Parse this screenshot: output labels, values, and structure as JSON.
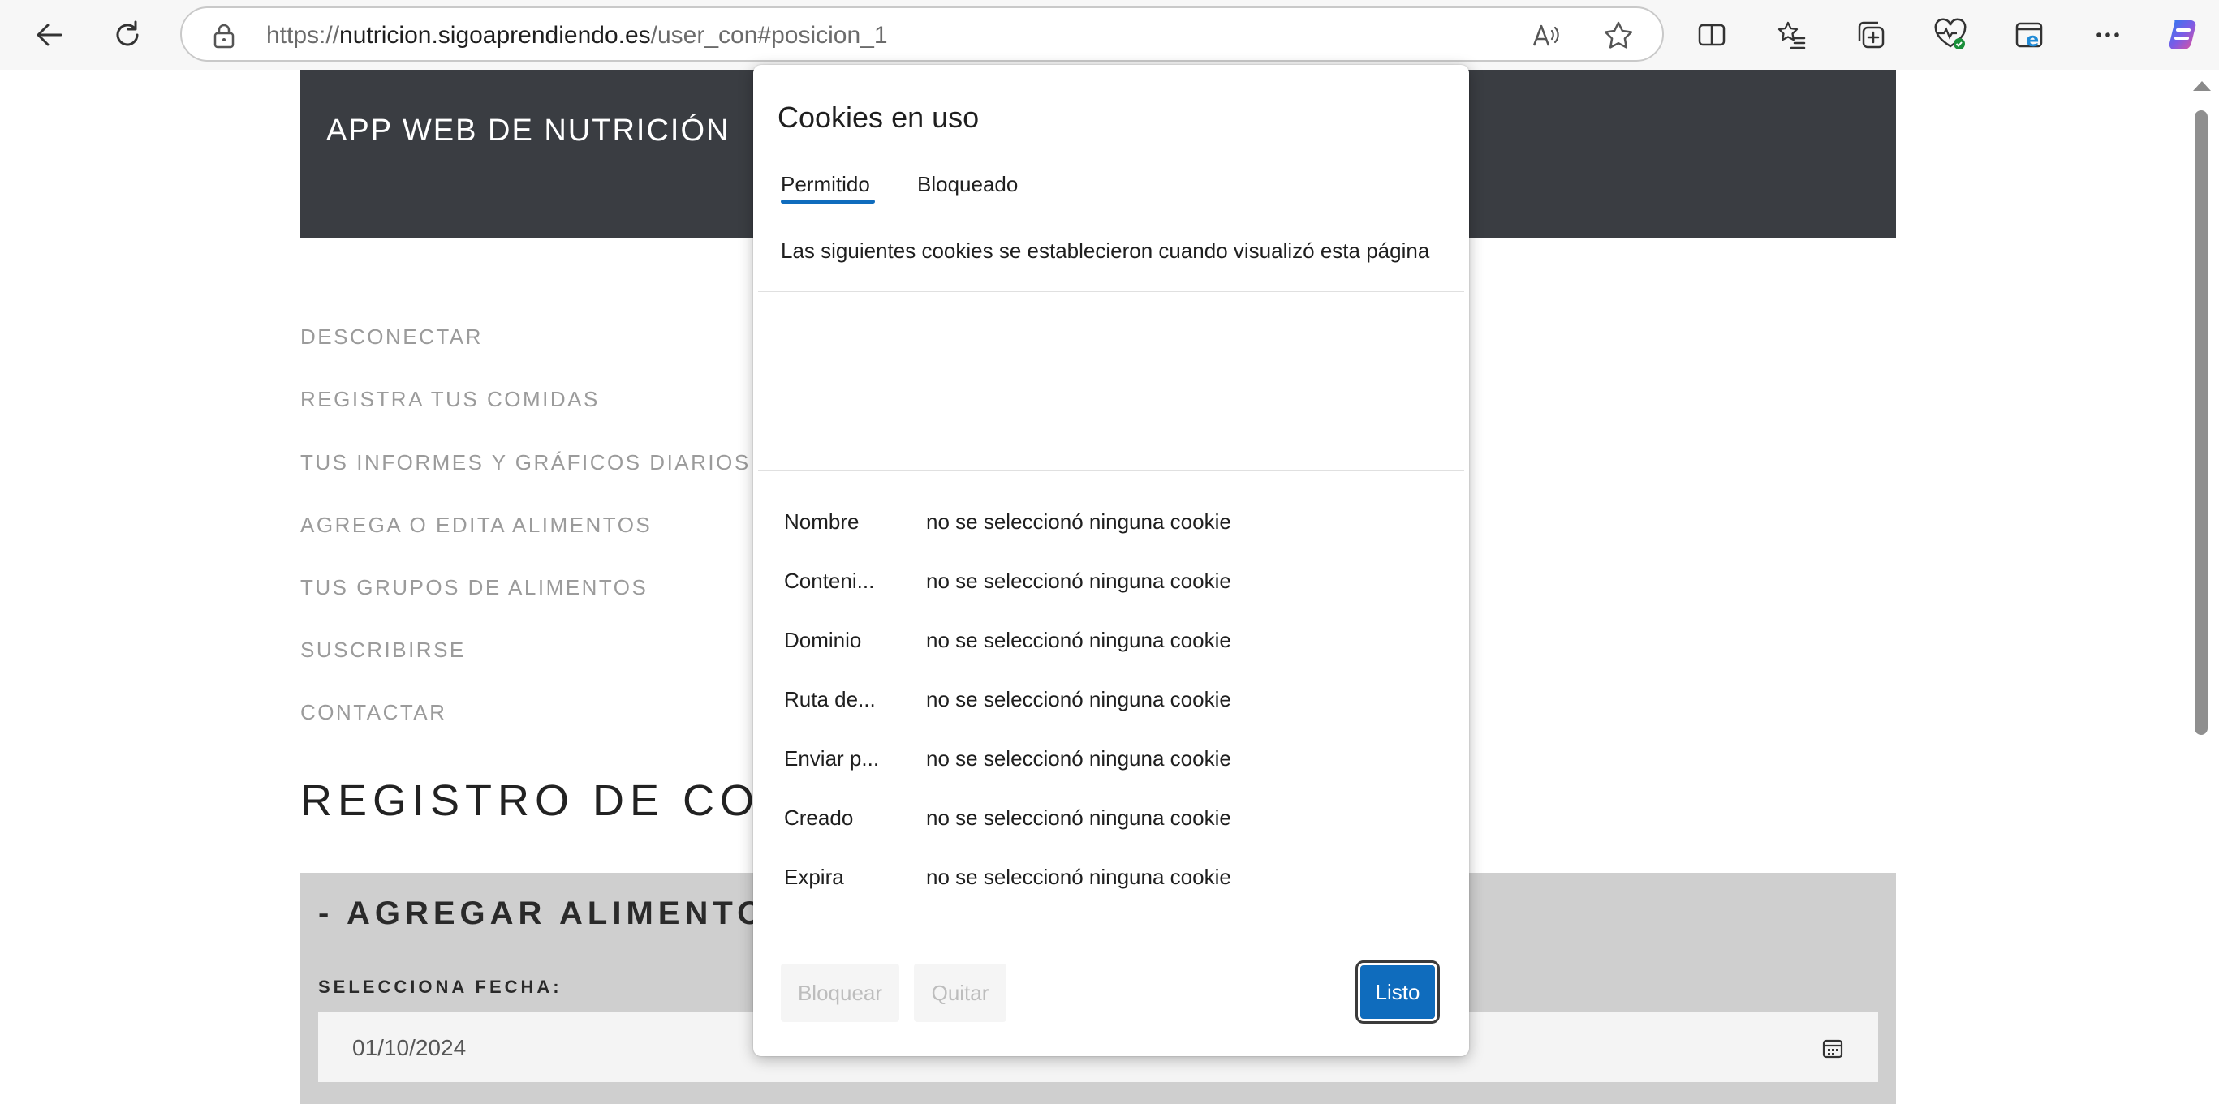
{
  "browser": {
    "url_prefix": "https://",
    "url_host": "nutricion.sigoaprendiendo.es",
    "url_path": "/user_con#posicion_1"
  },
  "site": {
    "title": "APP WEB DE NUTRICIÓN",
    "nav": [
      "DESCONECTAR",
      "REGISTRA TUS COMIDAS",
      "TUS INFORMES Y GRÁFICOS DIARIOS",
      "AGREGA O EDITA ALIMENTOS",
      "TUS GRUPOS DE ALIMENTOS",
      "SUSCRIBIRSE",
      "CONTACTAR"
    ],
    "page_heading": "REGISTRO DE COMID",
    "panel_title": "- AGREGAR ALIMENTOS -",
    "date_label": "SELECCIONA FECHA:",
    "date_value": "01/10/2024"
  },
  "cookie_popup": {
    "title": "Cookies en uso",
    "tabs": [
      "Permitido",
      "Bloqueado"
    ],
    "active_tab": "Permitido",
    "description": "Las siguientes cookies se establecieron cuando visualizó esta página",
    "details": [
      {
        "key": "Nombre",
        "value": "no se seleccionó ninguna cookie"
      },
      {
        "key": "Conteni...",
        "value": "no se seleccionó ninguna cookie"
      },
      {
        "key": "Dominio",
        "value": "no se seleccionó ninguna cookie"
      },
      {
        "key": "Ruta de...",
        "value": "no se seleccionó ninguna cookie"
      },
      {
        "key": "Enviar p...",
        "value": "no se seleccionó ninguna cookie"
      },
      {
        "key": "Creado",
        "value": "no se seleccionó ninguna cookie"
      },
      {
        "key": "Expira",
        "value": "no se seleccionó ninguna cookie"
      }
    ],
    "buttons": {
      "block": "Bloquear",
      "remove": "Quitar",
      "done": "Listo"
    }
  },
  "colors": {
    "accent": "#0f6cbd",
    "header_bg": "#3a3d42",
    "panel_bg": "#cfcfcf"
  }
}
